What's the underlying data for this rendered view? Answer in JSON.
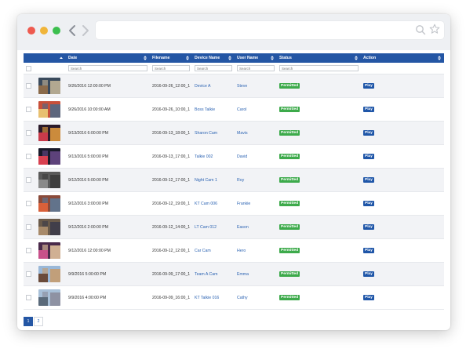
{
  "table": {
    "columns": [
      {
        "key": "check",
        "label": ""
      },
      {
        "key": "thumb",
        "label": ""
      },
      {
        "key": "date",
        "label": "Date"
      },
      {
        "key": "filename",
        "label": "Filename"
      },
      {
        "key": "device",
        "label": "Device Name"
      },
      {
        "key": "user",
        "label": "User Name"
      },
      {
        "key": "status",
        "label": "Status"
      },
      {
        "key": "action",
        "label": "Action"
      }
    ],
    "search_placeholder": "Search",
    "rows": [
      {
        "date": "9/26/2016 12:00:00 PM",
        "filename": "2016-09-26_12:00_1",
        "device": "Device A",
        "user": "Steve",
        "status": "Permitted",
        "action": "Play",
        "thumb_colors": [
          "#3a4a5c",
          "#8a6a4a",
          "#c8b89a"
        ]
      },
      {
        "date": "9/26/2016 10:00:00 AM",
        "filename": "2016-09-26_10:00_1",
        "device": "Boss Talkie",
        "user": "Carol",
        "status": "Permitted",
        "action": "Play",
        "thumb_colors": [
          "#c8503a",
          "#e8c070",
          "#4a6a8a"
        ]
      },
      {
        "date": "9/13/2016 6:00:00 PM",
        "filename": "2016-09-13_18:00_1",
        "device": "Sharon Cam",
        "user": "Mavis",
        "status": "Permitted",
        "action": "Play",
        "thumb_colors": [
          "#2a1a2a",
          "#c83a4a",
          "#e8a040"
        ]
      },
      {
        "date": "9/13/2016 5:00:00 PM",
        "filename": "2016-09-13_17:00_1",
        "device": "Talkie 002",
        "user": "David",
        "status": "Permitted",
        "action": "Play",
        "thumb_colors": [
          "#1a1a2a",
          "#d84050",
          "#6a4a8a"
        ]
      },
      {
        "date": "9/12/2016 5:00:00 PM",
        "filename": "2016-09-12_17:00_1",
        "device": "Night Cam 1",
        "user": "Roy",
        "status": "Permitted",
        "action": "Play",
        "thumb_colors": [
          "#5a5a5a",
          "#8a8a8a",
          "#3a3a3a"
        ]
      },
      {
        "date": "9/12/2016 3:00:00 PM",
        "filename": "2016-09-12_19:00_1",
        "device": "KT Cam 006",
        "user": "Frankie",
        "status": "Permitted",
        "action": "Play",
        "thumb_colors": [
          "#8a4a3a",
          "#d8603a",
          "#5a7a9a"
        ]
      },
      {
        "date": "9/12/2016 2:00:00 PM",
        "filename": "2016-09-12_14:00_1",
        "device": "LT Cam 012",
        "user": "Eason",
        "status": "Permitted",
        "action": "Play",
        "thumb_colors": [
          "#6a5a4a",
          "#a88a6a",
          "#3a3a4a"
        ]
      },
      {
        "date": "9/12/2016 12:00:00 PM",
        "filename": "2016-09-12_12:00_1",
        "device": "Car Cam",
        "user": "Hero",
        "status": "Permitted",
        "action": "Play",
        "thumb_colors": [
          "#4a2a4a",
          "#c8508a",
          "#e8c8a0"
        ]
      },
      {
        "date": "9/9/2016 5:00:00 PM",
        "filename": "2016-09-09_17:00_1",
        "device": "Team A Cam",
        "user": "Emma",
        "status": "Permitted",
        "action": "Play",
        "thumb_colors": [
          "#9ab8d8",
          "#6a4a3a",
          "#c89a6a"
        ]
      },
      {
        "date": "9/9/2016 4:00:00 PM",
        "filename": "2016-09-09_16:00_1",
        "device": "KT Talkie 016",
        "user": "Cathy",
        "status": "Permitted",
        "action": "Play",
        "thumb_colors": [
          "#a8c0d8",
          "#5a6a7a",
          "#8a8a9a"
        ]
      }
    ]
  },
  "pagination": {
    "pages": [
      "1",
      "2"
    ],
    "active": "1"
  },
  "colors": {
    "header": "#2456a4",
    "permitted": "#3daa4b",
    "play": "#1f56a8",
    "link": "#2d64b3"
  },
  "icons": {
    "window_controls": [
      "close-dot",
      "minimize-dot",
      "zoom-dot"
    ],
    "nav": [
      "chevron-left-icon",
      "chevron-right-icon"
    ],
    "address_bar": [
      "search-icon",
      "star-icon"
    ],
    "sort": "sort-icon"
  }
}
